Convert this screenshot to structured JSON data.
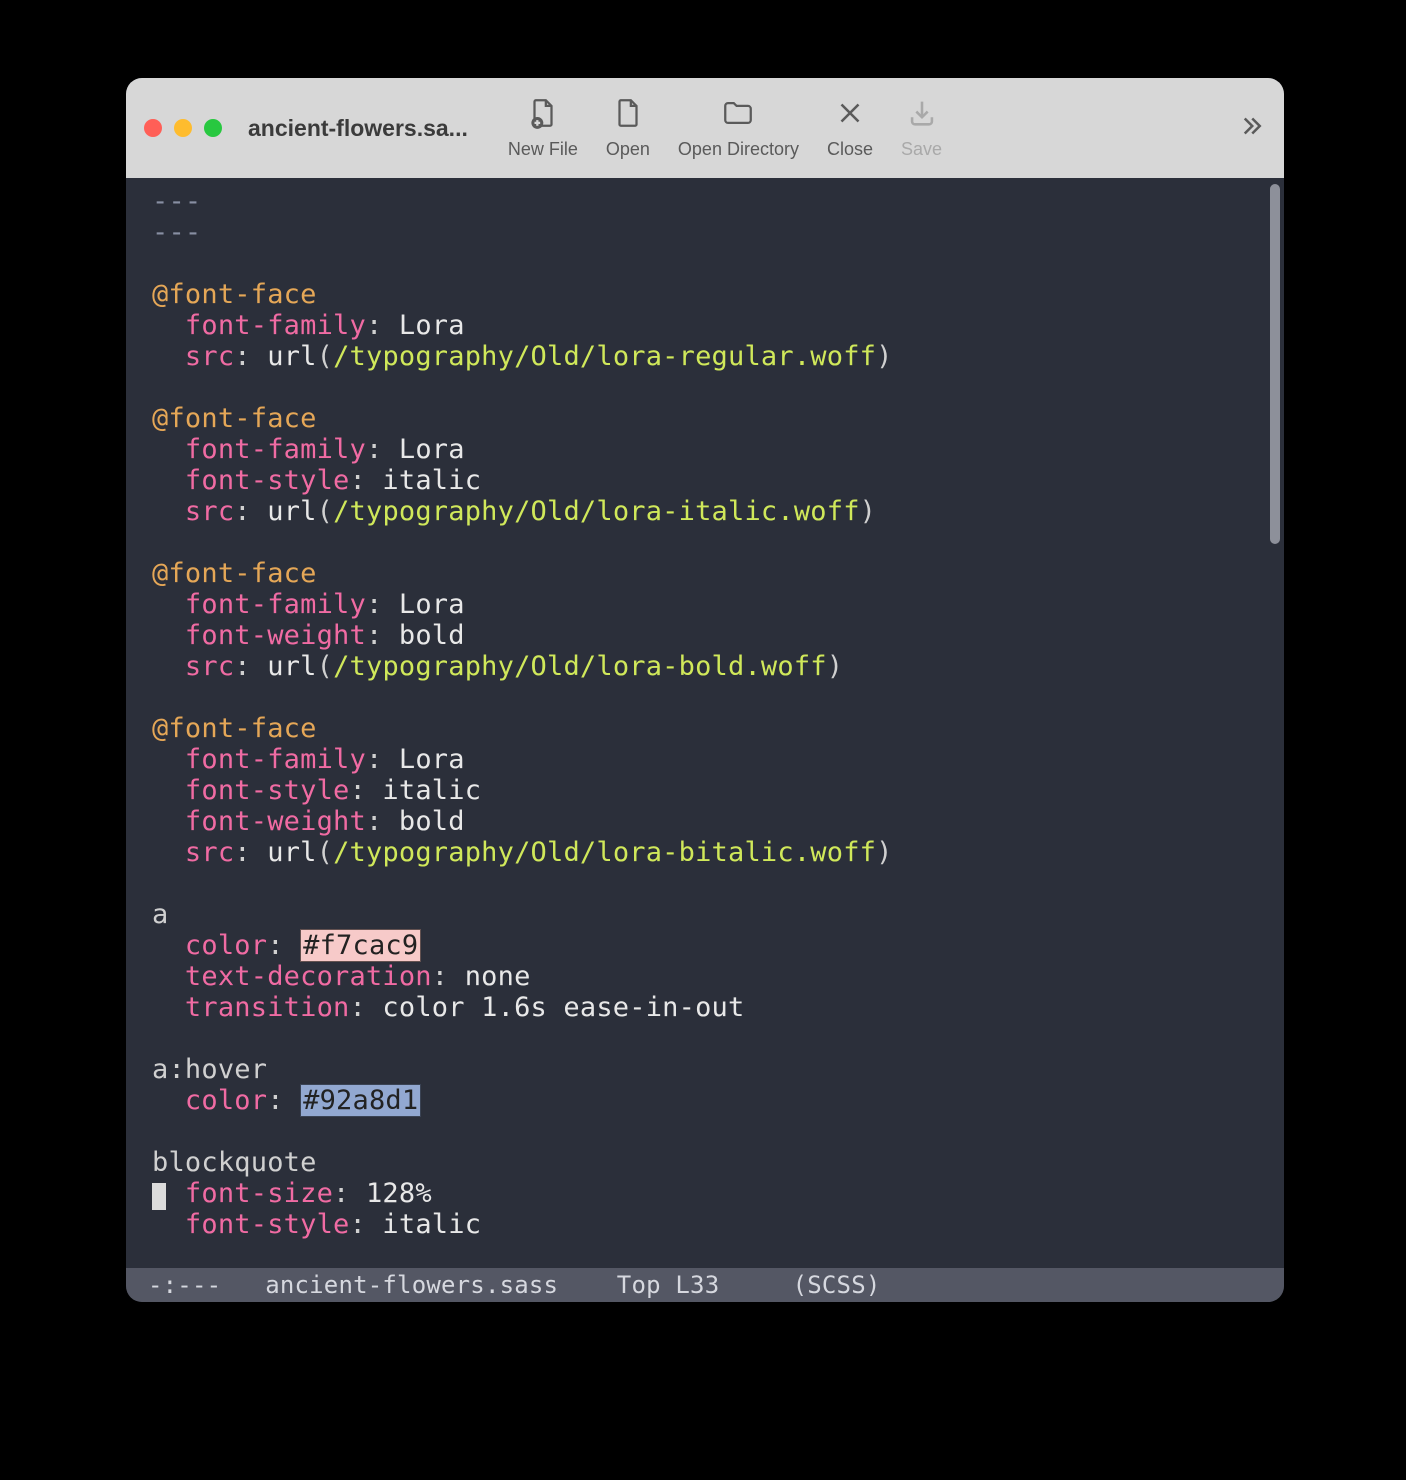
{
  "window": {
    "title": "ancient-flowers.sa..."
  },
  "toolbar": {
    "new_file": "New File",
    "open": "Open",
    "open_dir": "Open Directory",
    "close": "Close",
    "save": "Save"
  },
  "modeline": {
    "status": "-:---",
    "buffer": "ancient-flowers.sass",
    "pos": "Top L33",
    "mode": "(SCSS)"
  },
  "code": {
    "dash3a": "---",
    "dash3b": "---",
    "fontface": "@font-face",
    "ff_family": "font-family",
    "ff_src": "src",
    "ff_style": "font-style",
    "ff_weight": "font-weight",
    "lora": "Lora",
    "italic": "italic",
    "bold": "bold",
    "url_kw": "url",
    "lp": "(",
    "rp": ")",
    "colon": ":",
    "sp": " ",
    "path_reg": "/typography/Old/lora-regular.woff",
    "path_it": "/typography/Old/lora-italic.woff",
    "path_bd": "/typography/Old/lora-bold.woff",
    "path_bi": "/typography/Old/lora-bitalic.woff",
    "sel_a": "a",
    "color": "color",
    "textdeco": "text-decoration",
    "none": "none",
    "transition": "transition",
    "trans_val": "color 1.6s ease-in-out",
    "ahover": "a:hover",
    "hex1": "#f7cac9",
    "hex2": "#92a8d1",
    "blockquote": "blockquote",
    "fontsize": "font-size",
    "fs128": "128%"
  },
  "colors": {
    "swatch1": "#f7cac9",
    "swatch2": "#92a8d1"
  }
}
